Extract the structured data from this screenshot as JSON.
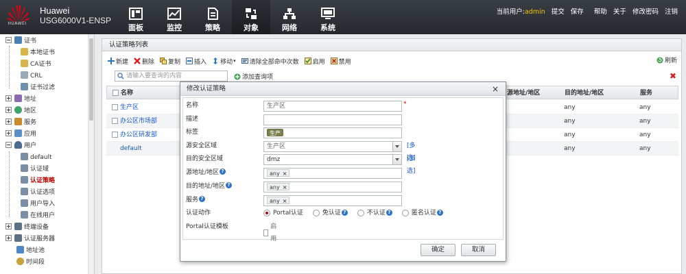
{
  "header": {
    "logo_text": "HUAWEI",
    "brand_name": "Huawei",
    "device_model": "USG6000V1-ENSP",
    "nav": [
      {
        "label": "面板",
        "icon": "dashboard-icon"
      },
      {
        "label": "监控",
        "icon": "monitor-icon"
      },
      {
        "label": "策略",
        "icon": "policy-icon"
      },
      {
        "label": "对象",
        "icon": "object-icon",
        "active": true
      },
      {
        "label": "网络",
        "icon": "network-icon"
      },
      {
        "label": "系统",
        "icon": "system-icon"
      }
    ],
    "current_user_label": "当前用户:",
    "current_user": "admin",
    "links": [
      "提交",
      "保存",
      "帮助",
      "关于",
      "修改密码",
      "注销"
    ]
  },
  "sidebar": {
    "items": [
      {
        "label": "证书",
        "level": 0,
        "expanded": true,
        "icon": "certificate-icon"
      },
      {
        "label": "本地证书",
        "level": 1,
        "icon": "local-cert-icon"
      },
      {
        "label": "CA证书",
        "level": 1,
        "icon": "ca-cert-icon"
      },
      {
        "label": "CRL",
        "level": 1,
        "icon": "crl-icon"
      },
      {
        "label": "证书过滤",
        "level": 1,
        "icon": "cert-filter-icon"
      },
      {
        "label": "地址",
        "level": 0,
        "expanded": false,
        "icon": "address-icon"
      },
      {
        "label": "地区",
        "level": 0,
        "expanded": false,
        "icon": "region-icon"
      },
      {
        "label": "服务",
        "level": 0,
        "expanded": false,
        "icon": "service-icon"
      },
      {
        "label": "应用",
        "level": 0,
        "expanded": false,
        "icon": "application-icon"
      },
      {
        "label": "用户",
        "level": 0,
        "expanded": true,
        "icon": "user-icon"
      },
      {
        "label": "default",
        "level": 1,
        "icon": "default-domain-icon"
      },
      {
        "label": "认证域",
        "level": 1,
        "icon": "auth-domain-icon"
      },
      {
        "label": "认证策略",
        "level": 1,
        "icon": "auth-policy-icon",
        "selected": true
      },
      {
        "label": "认证选项",
        "level": 1,
        "icon": "auth-option-icon"
      },
      {
        "label": "用户导入",
        "level": 1,
        "icon": "user-import-icon"
      },
      {
        "label": "在线用户",
        "level": 1,
        "icon": "online-user-icon"
      },
      {
        "label": "终端设备",
        "level": 0,
        "expanded": false,
        "icon": "terminal-icon"
      },
      {
        "label": "认证服务器",
        "level": 0,
        "expanded": false,
        "icon": "auth-server-icon"
      },
      {
        "label": "地址池",
        "level": 0,
        "icon": "address-pool-icon"
      },
      {
        "label": "时间段",
        "level": 0,
        "icon": "time-range-icon"
      }
    ]
  },
  "main": {
    "title": "认证策略列表",
    "toolbar": {
      "new": "新建",
      "delete": "删除",
      "copy": "复制",
      "insert": "插入",
      "move": "移动",
      "clear_hits": "清除全部命中次数",
      "enable": "启用",
      "disable": "禁用",
      "refresh": "刷新"
    },
    "search_placeholder": "请输入要查询的内容",
    "add_query": "添加查询项",
    "columns": [
      "名称",
      "源地址/地区",
      "目的地址/地区",
      "服务"
    ],
    "rows": [
      {
        "name": "生产区",
        "dst": "any",
        "service": "any"
      },
      {
        "name": "办公区市场部",
        "dst": "any",
        "service": "any"
      },
      {
        "name": "办公区研发部",
        "dst": "any",
        "service": "any"
      },
      {
        "name": "default",
        "dst": "any",
        "service": "any"
      }
    ]
  },
  "dialog": {
    "title": "修改认证策略",
    "fields": {
      "name_label": "名称",
      "name_value": "生产区",
      "required_mark": "*",
      "desc_label": "描述",
      "desc_value": "",
      "tag_label": "标签",
      "tag_value": "生产",
      "src_zone_label": "源安全区域",
      "src_zone_value": "生产区",
      "dst_zone_label": "目的安全区域",
      "dst_zone_value": "dmz",
      "multi_select": "[多选]",
      "src_addr_label": "源地址/地区",
      "dst_addr_label": "目的地址/地区",
      "service_label": "服务",
      "any": "any",
      "auth_action_label": "认证动作",
      "auth_actions": [
        "Portal认证",
        "免认证",
        "不认证",
        "匿名认证"
      ],
      "portal_template_label": "Portal认证模板",
      "enable_label": "启用"
    },
    "ok": "确定",
    "cancel": "取消"
  }
}
